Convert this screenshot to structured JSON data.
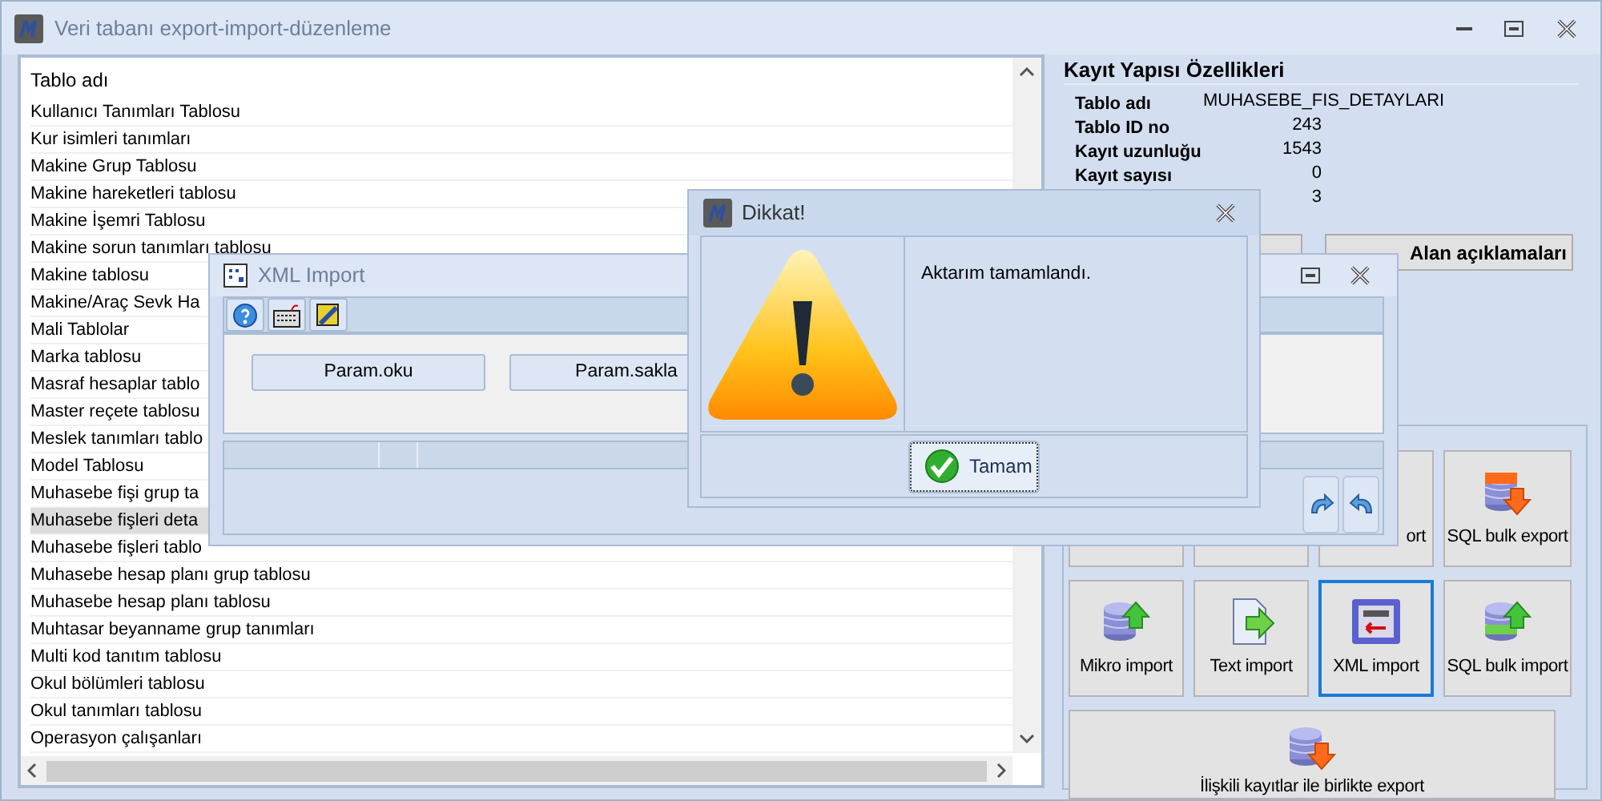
{
  "window": {
    "title": "Veri tabanı export-import-düzenleme"
  },
  "table": {
    "column": "Tablo adı",
    "rows": [
      {
        "name": "Kullanıcı Tanımları Tablosu",
        "selected": false
      },
      {
        "name": "Kur isimleri tanımları",
        "selected": false
      },
      {
        "name": "Makine Grup Tablosu",
        "selected": false
      },
      {
        "name": "Makine hareketleri tablosu",
        "selected": false
      },
      {
        "name": "Makine İşemri Tablosu",
        "selected": false
      },
      {
        "name": "Makine sorun tanımları tablosu",
        "selected": false
      },
      {
        "name": "Makine tablosu",
        "selected": false
      },
      {
        "name": "Makine/Araç Sevk Ha",
        "selected": false
      },
      {
        "name": "Mali Tablolar",
        "selected": false
      },
      {
        "name": "Marka tablosu",
        "selected": false
      },
      {
        "name": "Masraf hesaplar tablo",
        "selected": false
      },
      {
        "name": "Master reçete tablosu",
        "selected": false
      },
      {
        "name": "Meslek tanımları tablo",
        "selected": false
      },
      {
        "name": "Model Tablosu",
        "selected": false
      },
      {
        "name": "Muhasebe fişi grup ta",
        "selected": false
      },
      {
        "name": "Muhasebe fişleri deta",
        "selected": true
      },
      {
        "name": "Muhasebe fişleri tablo",
        "selected": false
      },
      {
        "name": "Muhasebe hesap planı grup tablosu",
        "selected": false
      },
      {
        "name": "Muhasebe hesap planı tablosu",
        "selected": false
      },
      {
        "name": "Muhtasar beyanname grup tanımları",
        "selected": false
      },
      {
        "name": "Multi kod tanıtım tablosu",
        "selected": false
      },
      {
        "name": "Okul bölümleri tablosu",
        "selected": false
      },
      {
        "name": "Okul tanımları tablosu",
        "selected": false
      },
      {
        "name": "Operasyon çalışanları",
        "selected": false
      }
    ]
  },
  "properties": {
    "title": "Kayıt Yapısı Özellikleri",
    "rows": [
      {
        "label": "Tablo adı",
        "value": "MUHASEBE_FIS_DETAYLARI",
        "kind": "text"
      },
      {
        "label": "Tablo ID no",
        "value": "243",
        "kind": "number"
      },
      {
        "label": "Kayıt uzunluğu",
        "value": "1543",
        "kind": "number"
      },
      {
        "label": "Kayıt sayısı",
        "value": "0",
        "kind": "number"
      },
      {
        "value": "3",
        "kind": "number"
      }
    ],
    "field_button": "Alan açıklamaları"
  },
  "actions": [
    {
      "kind": "covered",
      "selected": false
    },
    {
      "kind": "covered",
      "selected": false
    },
    {
      "kind": "covered",
      "label": "ort",
      "selected": false
    },
    {
      "kind": "sql-export",
      "label": "SQL bulk export",
      "selected": false
    },
    {
      "kind": "db-import",
      "label": "Mikro import",
      "selected": false
    },
    {
      "kind": "text-import",
      "label": "Text import",
      "selected": false
    },
    {
      "kind": "xml-import",
      "label": "XML import",
      "selected": true
    },
    {
      "kind": "sql-import",
      "label": "SQL bulk import",
      "selected": false
    },
    {
      "kind": "wide-db-export",
      "label": "İlişkili kayıtlar ile birlikte export",
      "selected": false
    }
  ],
  "xml_window": {
    "title": "XML Import",
    "buttons": [
      "Param.oku",
      "Param.sakla"
    ]
  },
  "dialog": {
    "title": "Dikkat!",
    "message": "Aktarım tamamlandı.",
    "button": "Tamam"
  }
}
